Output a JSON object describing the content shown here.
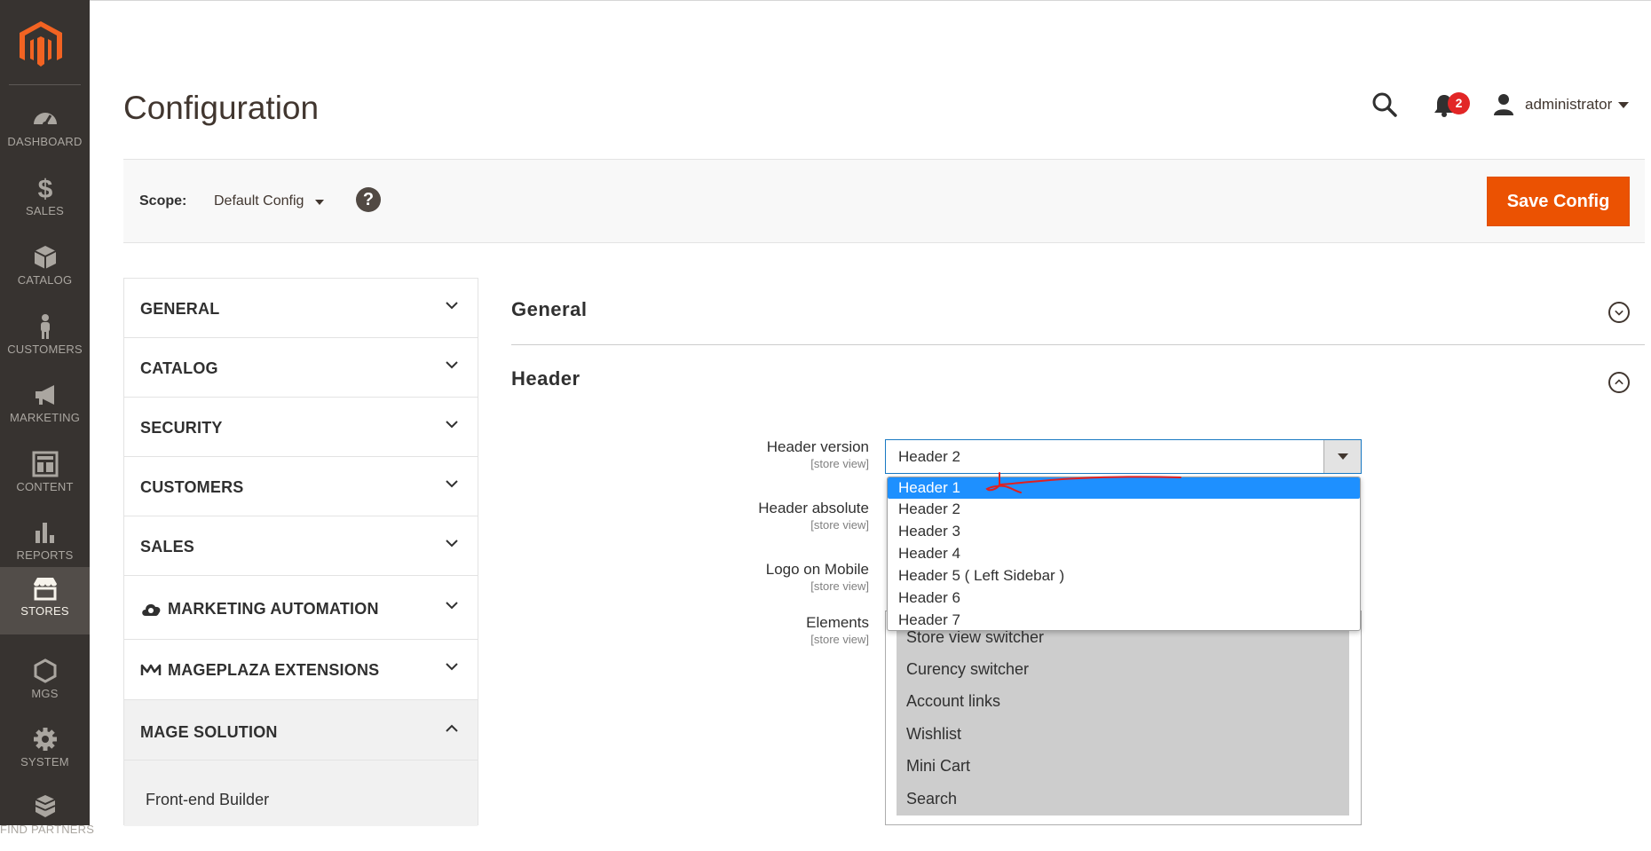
{
  "menu": {
    "items": [
      {
        "label": "DASHBOARD",
        "icon": "dashboard-icon"
      },
      {
        "label": "SALES",
        "icon": "dollar-icon"
      },
      {
        "label": "CATALOG",
        "icon": "box-icon"
      },
      {
        "label": "CUSTOMERS",
        "icon": "person-icon"
      },
      {
        "label": "MARKETING",
        "icon": "megaphone-icon"
      },
      {
        "label": "CONTENT",
        "icon": "layout-icon"
      },
      {
        "label": "REPORTS",
        "icon": "bar-chart-icon"
      },
      {
        "label": "STORES",
        "icon": "store-icon"
      },
      {
        "label": "MGS",
        "icon": "hexagon-icon"
      },
      {
        "label": "SYSTEM",
        "icon": "gear-icon"
      },
      {
        "label": "FIND PARTNERS",
        "icon": "cubes-icon"
      }
    ],
    "active": "STORES"
  },
  "header": {
    "title": "Configuration",
    "notifications_count": "2",
    "user": "administrator"
  },
  "scope": {
    "label": "Scope:",
    "value": "Default Config",
    "help": "?",
    "save_label": "Save Config"
  },
  "tabs": {
    "items": [
      "GENERAL",
      "CATALOG",
      "SECURITY",
      "CUSTOMERS",
      "SALES",
      "MARKETING AUTOMATION",
      "MAGEPLAZA EXTENSIONS",
      "MAGE SOLUTION"
    ],
    "open_subitem": "Front-end Builder"
  },
  "sections": {
    "general": "General",
    "header": "Header"
  },
  "fields": {
    "header_version": {
      "label": "Header version",
      "scope": "[store view]",
      "value": "Header 2"
    },
    "header_absolute": {
      "label": "Header absolute",
      "scope": "[store view]"
    },
    "logo_mobile": {
      "label": "Logo on Mobile",
      "scope": "[store view]"
    },
    "elements": {
      "label": "Elements",
      "scope": "[store view]",
      "options": [
        "Store view switcher",
        "Curency switcher",
        "Account links",
        "Wishlist",
        "Mini Cart",
        "Search"
      ]
    }
  },
  "dropdown": {
    "options": [
      "Header 1",
      "Header 2",
      "Header 3",
      "Header 4",
      "Header 5 ( Left Sidebar )",
      "Header 6",
      "Header 7"
    ],
    "highlighted": "Header 1"
  },
  "colors": {
    "menu_bg": "#373330",
    "menu_active_bg": "#524d49",
    "accent": "#eb5202",
    "badge": "#e22626",
    "dropdown_highlight": "#1e90ff",
    "annotation": "#e02020"
  }
}
